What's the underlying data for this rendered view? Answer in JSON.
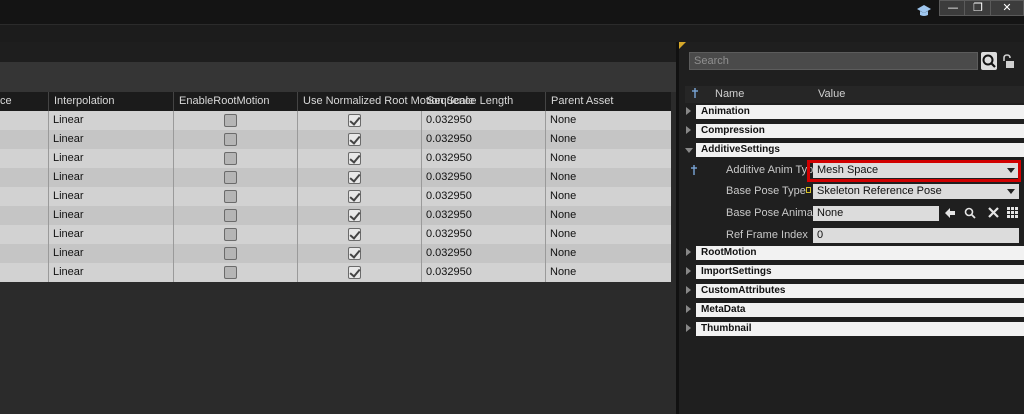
{
  "window": {
    "controls": {
      "minimize": "—",
      "restore": "❐",
      "close": "✕"
    }
  },
  "table": {
    "columns": [
      "ce",
      "Interpolation",
      "EnableRootMotion",
      "Use Normalized Root Motion Scale",
      "Sequence Length",
      "Parent Asset"
    ],
    "rows": [
      {
        "interpolation": "Linear",
        "enable_root_motion": false,
        "use_normalized": true,
        "sequence_length": "0.032950",
        "parent_asset": "None"
      },
      {
        "interpolation": "Linear",
        "enable_root_motion": false,
        "use_normalized": true,
        "sequence_length": "0.032950",
        "parent_asset": "None"
      },
      {
        "interpolation": "Linear",
        "enable_root_motion": false,
        "use_normalized": true,
        "sequence_length": "0.032950",
        "parent_asset": "None"
      },
      {
        "interpolation": "Linear",
        "enable_root_motion": false,
        "use_normalized": true,
        "sequence_length": "0.032950",
        "parent_asset": "None"
      },
      {
        "interpolation": "Linear",
        "enable_root_motion": false,
        "use_normalized": true,
        "sequence_length": "0.032950",
        "parent_asset": "None"
      },
      {
        "interpolation": "Linear",
        "enable_root_motion": false,
        "use_normalized": true,
        "sequence_length": "0.032950",
        "parent_asset": "None"
      },
      {
        "interpolation": "Linear",
        "enable_root_motion": false,
        "use_normalized": true,
        "sequence_length": "0.032950",
        "parent_asset": "None"
      },
      {
        "interpolation": "Linear",
        "enable_root_motion": false,
        "use_normalized": true,
        "sequence_length": "0.032950",
        "parent_asset": "None"
      },
      {
        "interpolation": "Linear",
        "enable_root_motion": false,
        "use_normalized": true,
        "sequence_length": "0.032950",
        "parent_asset": "None"
      }
    ]
  },
  "details": {
    "search_placeholder": "Search",
    "header": {
      "name": "Name",
      "value": "Value"
    },
    "categories_top": [
      "Animation",
      "Compression",
      "AdditiveSettings"
    ],
    "additive_settings": {
      "additive_anim_type": {
        "label": "Additive Anim Type",
        "value": "Mesh Space"
      },
      "base_pose_type": {
        "label": "Base Pose Type",
        "value": "Skeleton Reference Pose"
      },
      "base_pose_animation": {
        "label": "Base Pose Animation",
        "value": "None"
      },
      "ref_frame_index": {
        "label": "Ref Frame Index",
        "value": "0"
      }
    },
    "categories_bottom": [
      "RootMotion",
      "ImportSettings",
      "CustomAttributes",
      "MetaData",
      "Thumbnail"
    ]
  },
  "colors": {
    "highlight": "#d10000",
    "accent": "#d6a82a"
  }
}
